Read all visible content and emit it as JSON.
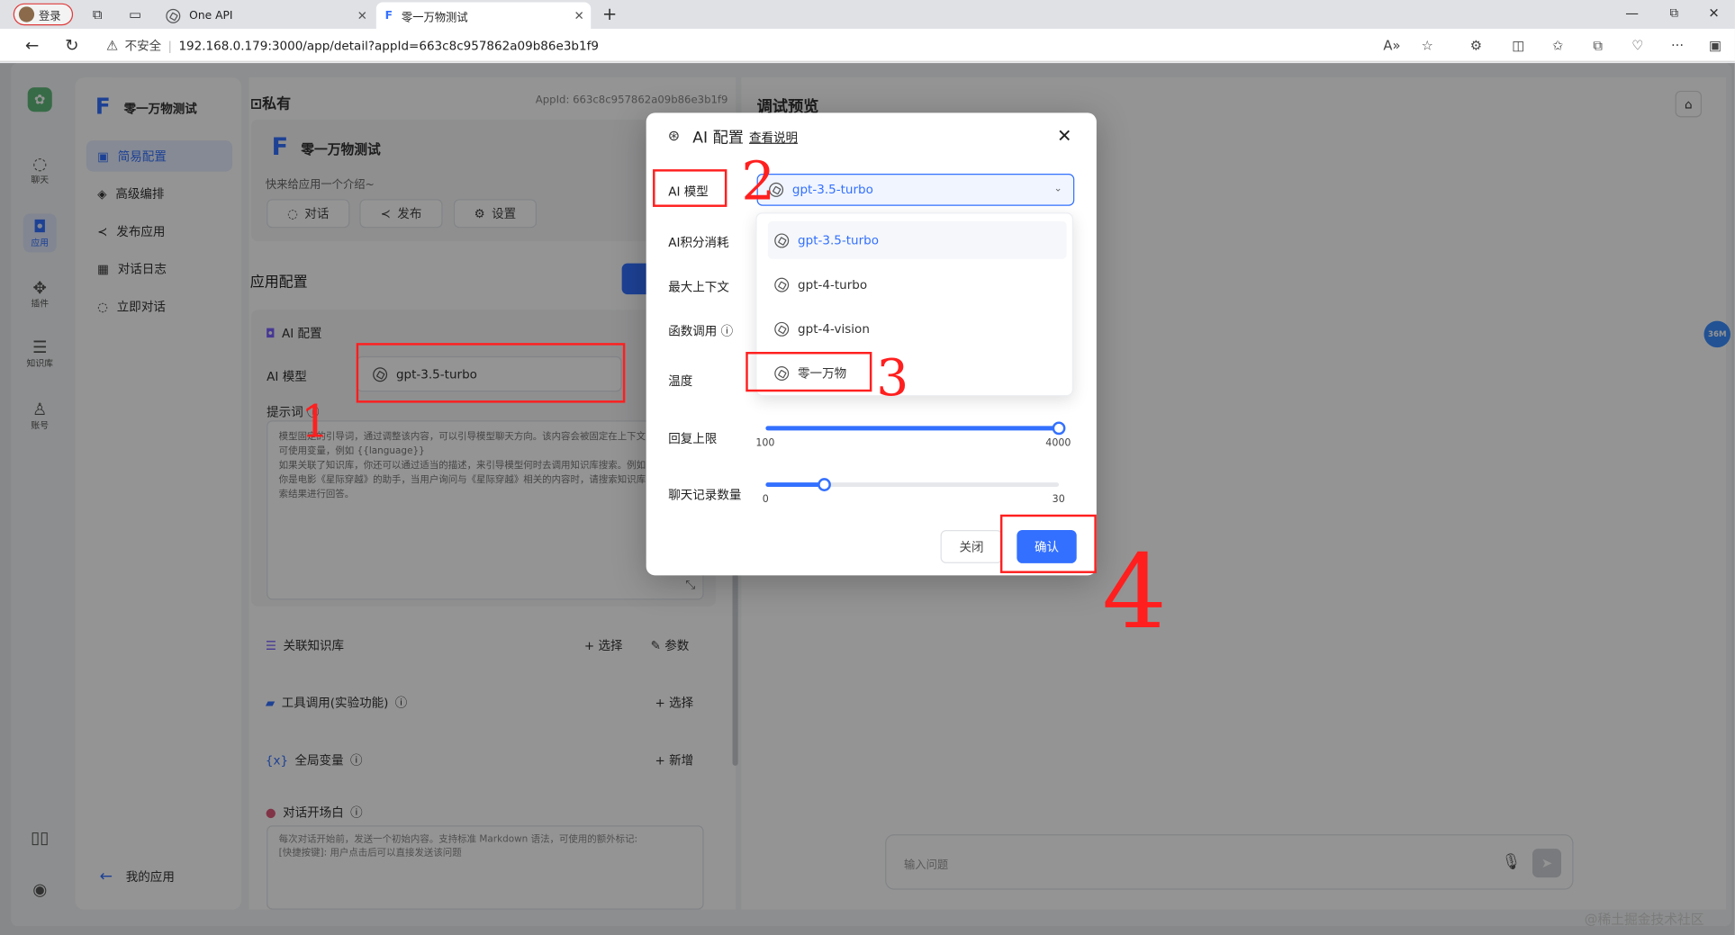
{
  "browser": {
    "login_label": "登录",
    "tab1_title": "One API",
    "tab2_title": "零一万物测试",
    "insecure_label": "不安全",
    "url": "192.168.0.179:3000/app/detail?appId=663c8c957862a09b86e3b1f9"
  },
  "nav": {
    "items": [
      {
        "label": "聊天"
      },
      {
        "label": "应用"
      },
      {
        "label": "插件"
      },
      {
        "label": "知识库"
      },
      {
        "label": "账号"
      }
    ]
  },
  "left": {
    "app_name": "零一万物测试",
    "menu": [
      {
        "label": "简易配置"
      },
      {
        "label": "高级编排"
      },
      {
        "label": "发布应用"
      },
      {
        "label": "对话日志"
      },
      {
        "label": "立即对话"
      }
    ],
    "my_apps": "我的应用"
  },
  "mid": {
    "private_label": "私有",
    "appid": "AppId: 663c8c957862a09b86e3b1f9",
    "app_name": "零一万物测试",
    "app_intro": "快来给应用一个介绍~",
    "btn_chat": "对话",
    "btn_publish": "发布",
    "btn_settings": "设置",
    "config_title": "应用配置",
    "ai_config": "AI 配置",
    "ai_model_label": "AI 模型",
    "ai_model_value": "gpt-3.5-turbo",
    "prompt_label": "提示词",
    "prompt_text": "模型固定的引导词，通过调整该内容，可以引导模型聊天方向。该内容会被固定在上下文的开头。可使用变量，例如 {{language}}\n如果关联了知识库，你还可以通过适当的描述，来引导模型何时去调用知识库搜索。例如：\n你是电影《星际穿越》的助手，当用户询问与《星际穿越》相关的内容时，请搜索知识库并结合搜索结果进行回答。",
    "kb_label": "关联知识库",
    "kb_select": "+ 选择",
    "kb_params": "参数",
    "tools_label": "工具调用(实验功能)",
    "tools_select": "+ 选择",
    "vars_label": "全局变量",
    "vars_add": "+ 新增",
    "opening_label": "对话开场白",
    "opening_placeholder": "每次对话开始前，发送一个初始内容。支持标准 Markdown 语法，可使用的额外标记:\n[快捷按键]: 用户点击后可以直接发送该问题"
  },
  "right": {
    "title": "调试预览",
    "input_placeholder": "输入问题",
    "badge": "36M"
  },
  "modal": {
    "title": "AI 配置",
    "help_link": "查看说明",
    "labels": {
      "model": "AI 模型",
      "points": "AI积分消耗",
      "context": "最大上下文",
      "functions": "函数调用",
      "temperature": "温度",
      "max_reply": "回复上限",
      "history": "聊天记录数量"
    },
    "selected_model": "gpt-3.5-turbo",
    "options": [
      {
        "label": "gpt-3.5-turbo"
      },
      {
        "label": "gpt-4-turbo"
      },
      {
        "label": "gpt-4-vision"
      },
      {
        "label": "零一万物"
      }
    ],
    "max_reply": {
      "min": "100",
      "max": "4000",
      "value_fraction": 1.0
    },
    "history": {
      "min": "0",
      "max": "30",
      "value_fraction": 0.2
    },
    "btn_close": "关闭",
    "btn_confirm": "确认"
  },
  "annotations": {
    "n1": "1",
    "n2": "2",
    "n3": "3",
    "n4": "4"
  },
  "watermark": "@稀土掘金技术社区",
  "colors": {
    "accent": "#3370ff",
    "annotation": "#ff1f1f"
  }
}
